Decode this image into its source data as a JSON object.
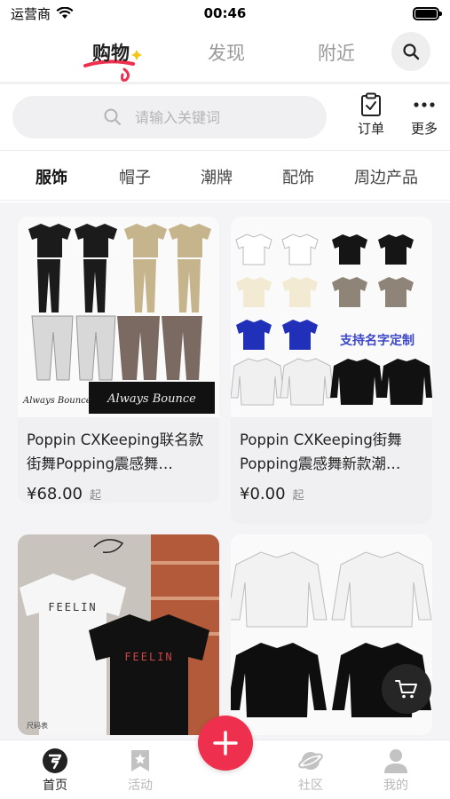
{
  "status_bar": {
    "carrier": "运营商",
    "time": "00:46"
  },
  "top_nav": {
    "tabs": [
      {
        "label": "购物"
      },
      {
        "label": "发现"
      },
      {
        "label": "附近"
      }
    ]
  },
  "search": {
    "placeholder": "请输入关键词",
    "value": ""
  },
  "actions": {
    "orders": "订单",
    "more": "更多"
  },
  "categories": [
    "服饰",
    "帽子",
    "潮牌",
    "配饰",
    "周边产品"
  ],
  "products": [
    {
      "title": "Poppin CXKeeping联名款街舞Popping震感舞…",
      "price": "¥68.00",
      "suffix": "起",
      "image_text": [
        "Always Bounce",
        "Always Bounce"
      ]
    },
    {
      "title": "Poppin CXKeeping街舞Popping震感舞新款潮…",
      "price": "¥0.00",
      "suffix": "起",
      "image_text": [
        "支持名字定制"
      ]
    },
    {
      "image_text": [
        "FEELIN",
        "FEELIN",
        "尺码表"
      ]
    },
    {}
  ],
  "bottom_nav": {
    "items": [
      {
        "label": "首页"
      },
      {
        "label": "活动"
      },
      {
        "label": "社区"
      },
      {
        "label": "我的"
      }
    ]
  },
  "colors": {
    "accent": "#ee2f4d",
    "text": "#222222",
    "inactive": "#b8b8b8"
  }
}
